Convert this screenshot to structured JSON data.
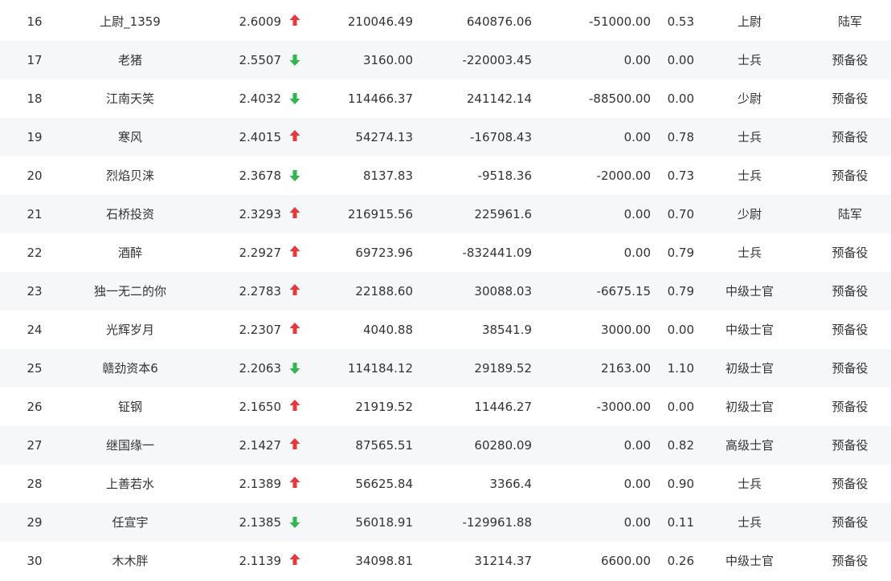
{
  "colors": {
    "up": "#e8383d",
    "down": "#2db84d",
    "alt_row_bg": "#f6f7f9",
    "text": "#333333"
  },
  "rows": [
    {
      "rank": "16",
      "name": "上尉_1359",
      "score": "2.6009",
      "trend": "up",
      "v1": "210046.49",
      "v2": "640876.06",
      "v3": "-51000.00",
      "v4": "0.53",
      "military_rank": "上尉",
      "branch": "陆军"
    },
    {
      "rank": "17",
      "name": "老猪",
      "score": "2.5507",
      "trend": "down",
      "v1": "3160.00",
      "v2": "-220003.45",
      "v3": "0.00",
      "v4": "0.00",
      "military_rank": "士兵",
      "branch": "预备役"
    },
    {
      "rank": "18",
      "name": "江南天笑",
      "score": "2.4032",
      "trend": "down",
      "v1": "114466.37",
      "v2": "241142.14",
      "v3": "-88500.00",
      "v4": "0.00",
      "military_rank": "少尉",
      "branch": "预备役"
    },
    {
      "rank": "19",
      "name": "寒风",
      "score": "2.4015",
      "trend": "up",
      "v1": "54274.13",
      "v2": "-16708.43",
      "v3": "0.00",
      "v4": "0.78",
      "military_rank": "士兵",
      "branch": "预备役"
    },
    {
      "rank": "20",
      "name": "烈焰贝涞",
      "score": "2.3678",
      "trend": "down",
      "v1": "8137.83",
      "v2": "-9518.36",
      "v3": "-2000.00",
      "v4": "0.73",
      "military_rank": "士兵",
      "branch": "预备役"
    },
    {
      "rank": "21",
      "name": "石桥投资",
      "score": "2.3293",
      "trend": "up",
      "v1": "216915.56",
      "v2": "225961.6",
      "v3": "0.00",
      "v4": "0.70",
      "military_rank": "少尉",
      "branch": "陆军"
    },
    {
      "rank": "22",
      "name": "酒醉",
      "score": "2.2927",
      "trend": "up",
      "v1": "69723.96",
      "v2": "-832441.09",
      "v3": "0.00",
      "v4": "0.79",
      "military_rank": "士兵",
      "branch": "预备役"
    },
    {
      "rank": "23",
      "name": "独一无二的你",
      "score": "2.2783",
      "trend": "up",
      "v1": "22188.60",
      "v2": "30088.03",
      "v3": "-6675.15",
      "v4": "0.79",
      "military_rank": "中级士官",
      "branch": "预备役"
    },
    {
      "rank": "24",
      "name": "光辉岁月",
      "score": "2.2307",
      "trend": "up",
      "v1": "4040.88",
      "v2": "38541.9",
      "v3": "3000.00",
      "v4": "0.00",
      "military_rank": "中级士官",
      "branch": "预备役"
    },
    {
      "rank": "25",
      "name": "赣劲资本6",
      "score": "2.2063",
      "trend": "down",
      "v1": "114184.12",
      "v2": "29189.52",
      "v3": "2163.00",
      "v4": "1.10",
      "military_rank": "初级士官",
      "branch": "预备役"
    },
    {
      "rank": "26",
      "name": "钲钢",
      "score": "2.1650",
      "trend": "up",
      "v1": "21919.52",
      "v2": "11446.27",
      "v3": "-3000.00",
      "v4": "0.00",
      "military_rank": "初级士官",
      "branch": "预备役"
    },
    {
      "rank": "27",
      "name": "继国缘一",
      "score": "2.1427",
      "trend": "up",
      "v1": "87565.51",
      "v2": "60280.09",
      "v3": "0.00",
      "v4": "0.82",
      "military_rank": "高级士官",
      "branch": "预备役"
    },
    {
      "rank": "28",
      "name": "上善若水",
      "score": "2.1389",
      "trend": "up",
      "v1": "56625.84",
      "v2": "3366.4",
      "v3": "0.00",
      "v4": "0.90",
      "military_rank": "士兵",
      "branch": "预备役"
    },
    {
      "rank": "29",
      "name": "任宣宇",
      "score": "2.1385",
      "trend": "down",
      "v1": "56018.91",
      "v2": "-129961.88",
      "v3": "0.00",
      "v4": "0.11",
      "military_rank": "士兵",
      "branch": "预备役"
    },
    {
      "rank": "30",
      "name": "木木胖",
      "score": "2.1139",
      "trend": "up",
      "v1": "34098.81",
      "v2": "31214.37",
      "v3": "6600.00",
      "v4": "0.26",
      "military_rank": "中级士官",
      "branch": "预备役"
    }
  ]
}
